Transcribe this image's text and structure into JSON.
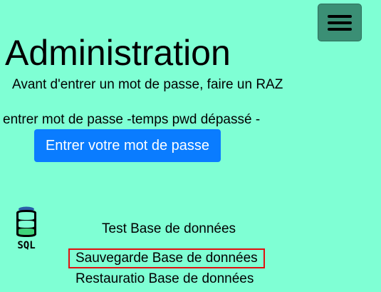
{
  "header": {
    "menu_icon": "hamburger-menu-icon"
  },
  "main": {
    "title": "Administration",
    "notice": "Avant d'entrer un mot de passe, faire un RAZ",
    "password_status": "entrer mot de passe -temps pwd dépassé -",
    "enter_password_label": "Entrer votre mot de passe"
  },
  "database": {
    "icon": "sql-database-icon",
    "icon_label": "SQL",
    "links": {
      "test": "Test Base de données",
      "save": "Sauvegarde Base de données",
      "restore": "Restauratio Base de données"
    }
  },
  "colors": {
    "background": "#7fffd4",
    "menu_button": "#3b8f75",
    "primary_button": "#0a7cff",
    "highlight_border": "#e01010"
  }
}
